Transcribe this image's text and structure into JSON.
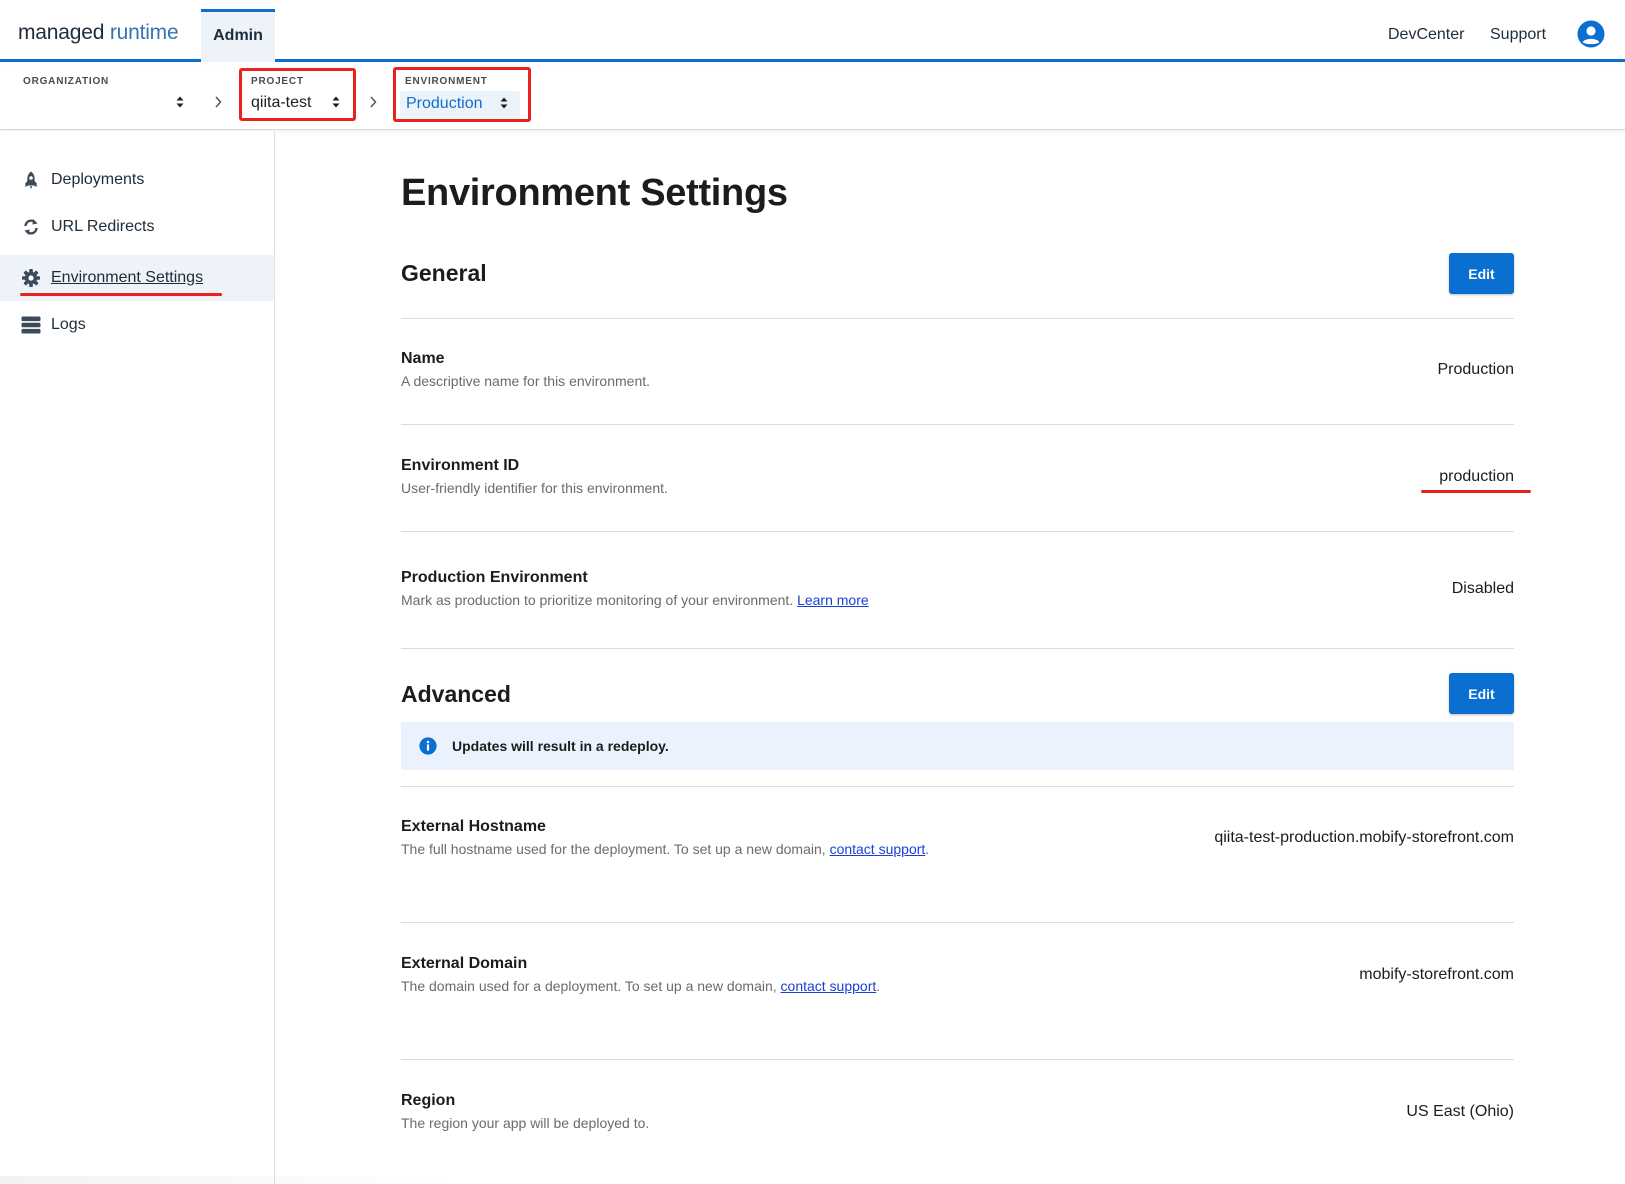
{
  "header": {
    "brand_part1": "managed",
    "brand_part2": "runtime",
    "active_tab": "Admin",
    "links": [
      "DevCenter",
      "Support"
    ]
  },
  "context": {
    "organization_label": "ORGANIZATION",
    "organization_value": "",
    "project_label": "PROJECT",
    "project_value": "qiita-test",
    "environment_label": "ENVIRONMENT",
    "environment_value": "Production"
  },
  "sidebar": {
    "items": [
      {
        "label": "Deployments",
        "icon": "rocket-icon"
      },
      {
        "label": "URL Redirects",
        "icon": "redirect-icon"
      },
      {
        "label": "Environment Settings",
        "icon": "gear-icon",
        "active": true
      },
      {
        "label": "Logs",
        "icon": "logs-icon"
      }
    ]
  },
  "main": {
    "title": "Environment Settings",
    "general": {
      "title": "General",
      "edit_label": "Edit",
      "rows": [
        {
          "title": "Name",
          "description": "A descriptive name for this environment.",
          "value": "Production"
        },
        {
          "title": "Environment ID",
          "description": "User-friendly identifier for this environment.",
          "value": "production"
        },
        {
          "title": "Production Environment",
          "description": "Mark as production to prioritize monitoring of your environment.",
          "link": "Learn more",
          "value": "Disabled"
        }
      ]
    },
    "advanced": {
      "title": "Advanced",
      "edit_label": "Edit",
      "banner": "Updates will result in a redeploy.",
      "rows": [
        {
          "title": "External Hostname",
          "description": "The full hostname used for the deployment. To set up a new domain,",
          "link": "contact support",
          "suffix": ".",
          "value": "qiita-test-production.mobify-storefront.com"
        },
        {
          "title": "External Domain",
          "description": "The domain used for a deployment. To set up a new domain,",
          "link": "contact support",
          "suffix": ".",
          "value": "mobify-storefront.com"
        },
        {
          "title": "Region",
          "description": "The region your app will be deployed to.",
          "value": "US East (Ohio)"
        }
      ]
    }
  },
  "colors": {
    "accent": "#0b6fd1",
    "annotation_red": "#e8231b",
    "banner_bg": "#eaf3fd",
    "link": "#1a3ed6"
  }
}
